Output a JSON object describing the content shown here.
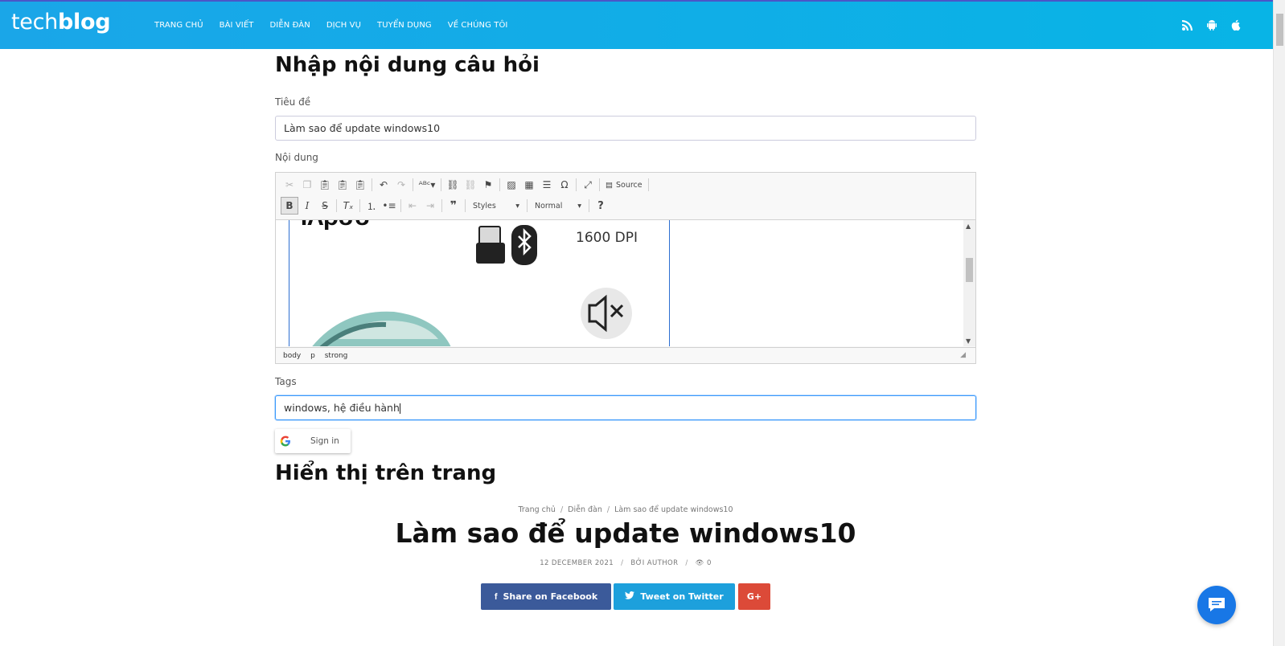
{
  "header": {
    "logo_thin": "tech",
    "logo_bold": "blog",
    "nav": [
      "TRANG CHỦ",
      "BÀI VIẾT",
      "DIỄN ĐÀN",
      "DỊCH VỤ",
      "TUYỂN DỤNG",
      "VỀ CHÚNG TÔI"
    ],
    "icons": [
      "rss-icon",
      "android-icon",
      "apple-icon"
    ]
  },
  "form": {
    "heading": "Nhập nội dung câu hỏi",
    "title_label": "Tiêu đề",
    "title_value": "Làm sao để update windows10",
    "content_label": "Nội dung",
    "tags_label": "Tags",
    "tags_value": "windows, hệ điều hành"
  },
  "editor": {
    "source_label": "Source",
    "styles_label": "Styles",
    "format_label": "Normal",
    "help_label": "?",
    "image_text_dpi": "1600 DPI",
    "path": [
      "body",
      "p",
      "strong"
    ]
  },
  "google": {
    "signin_label": "Sign in"
  },
  "preview": {
    "heading": "Hiển thị trên trang",
    "breadcrumb": [
      "Trang chủ",
      "Diễn đàn",
      "Làm sao để update windows10"
    ],
    "post_title": "Làm sao để update windows10",
    "date": "12 DECEMBER 2021",
    "author": "BỞI AUTHOR",
    "views": "0",
    "share_facebook": "Share on Facebook",
    "share_twitter": "Tweet on Twitter",
    "share_gplus": "G+"
  },
  "colors": {
    "header_gradient_start": "#1aa6e8",
    "header_gradient_end": "#08b4e6",
    "facebook": "#3b5a9a",
    "twitter": "#1da0dc",
    "gplus": "#dc4a38",
    "chat": "#1877e6"
  }
}
